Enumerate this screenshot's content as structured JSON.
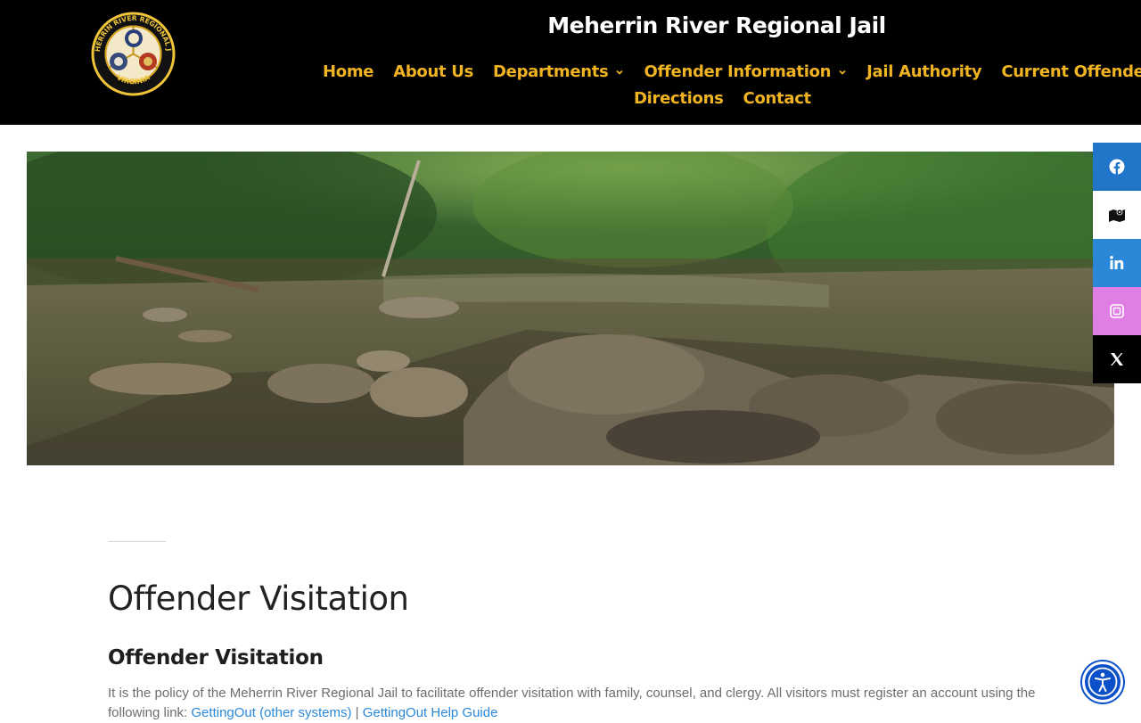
{
  "header": {
    "site_title": "Meherrin River Regional Jail",
    "logo_alt": "Meherrin River Regional Jail Virginia seal",
    "logo_text_top": "MEHERRIN RIVER REGIONAL JAIL",
    "logo_text_bottom": "VIRGINIA"
  },
  "nav": {
    "row1": [
      {
        "label": "Home"
      },
      {
        "label": "About Us"
      },
      {
        "label": "Departments",
        "has_dropdown": true
      },
      {
        "label": "Offender Information",
        "has_dropdown": true
      },
      {
        "label": "Jail Authority"
      },
      {
        "label": "Current Offenders"
      }
    ],
    "row2": [
      {
        "label": "Directions"
      },
      {
        "label": "Contact"
      }
    ]
  },
  "hero": {
    "description": "river with rocks and forest"
  },
  "social": [
    {
      "name": "facebook-icon",
      "color": "#2276c9"
    },
    {
      "name": "map-icon",
      "color": "#ffffff"
    },
    {
      "name": "linkedin-icon",
      "color": "#2b88d8"
    },
    {
      "name": "instagram-icon",
      "color": "#e07fe3"
    },
    {
      "name": "x-icon",
      "color": "#000000"
    }
  ],
  "content": {
    "title": "Offender Visitation",
    "subtitle": "Offender Visitation",
    "paragraph_start": "It is the policy of the Meherrin River Regional Jail to facilitate offender visitation with family, counsel, and clergy. All visitors must register an account using the following link: ",
    "link1": "GettingOut (other systems)",
    "link_sep": " | ",
    "link2": "GettingOut Help Guide"
  },
  "colors": {
    "header_bg": "#000000",
    "nav_text": "#f0b322",
    "accent_link": "#2b88d8",
    "a11y_button": "#0b4fc9"
  }
}
